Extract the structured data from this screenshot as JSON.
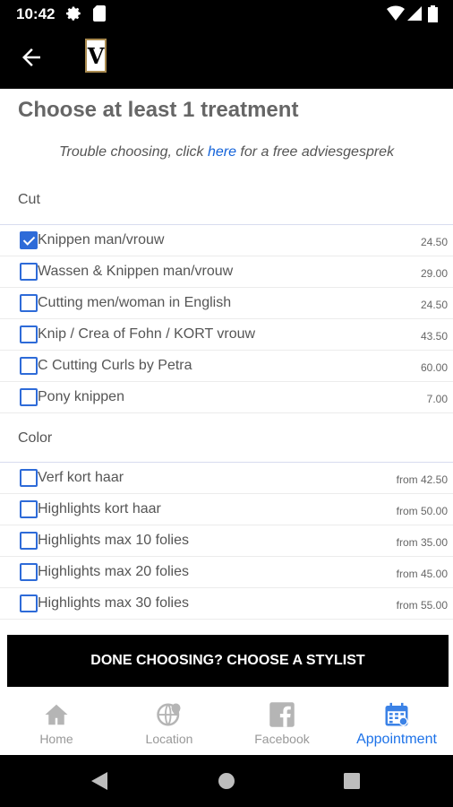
{
  "status_bar": {
    "time": "10:42",
    "icons": [
      "gear-icon",
      "sd-card-icon",
      "wifi-icon",
      "signal-icon",
      "battery-icon"
    ]
  },
  "app_bar": {
    "back_icon": "arrow-left-icon",
    "logo_text": "V"
  },
  "page": {
    "title": "Choose at least 1 treatment",
    "hint_prefix": "Trouble choosing, click ",
    "hint_link": "here",
    "hint_suffix": " for a free adviesgesprek"
  },
  "sections": [
    {
      "name": "Cut",
      "items": [
        {
          "label": "Knippen man/vrouw",
          "price": "24.50",
          "checked": true
        },
        {
          "label": "Wassen & Knippen man/vrouw",
          "price": "29.00",
          "checked": false
        },
        {
          "label": "Cutting men/woman in  English",
          "price": "24.50",
          "checked": false
        },
        {
          "label": "Knip / Crea of Fohn / KORT vrouw",
          "price": "43.50",
          "checked": false
        },
        {
          "label": "C Cutting Curls by Petra",
          "price": "60.00",
          "checked": false
        },
        {
          "label": "Pony knippen",
          "price": "7.00",
          "checked": false
        }
      ]
    },
    {
      "name": "Color",
      "items": [
        {
          "label": "Verf kort haar",
          "price": "from 42.50",
          "checked": false
        },
        {
          "label": "Highlights kort haar",
          "price": "from 50.00",
          "checked": false
        },
        {
          "label": "Highlights max 10 folies",
          "price": "from 35.00",
          "checked": false
        },
        {
          "label": "Highlights max 20 folies",
          "price": "from 45.00",
          "checked": false
        },
        {
          "label": "Highlights max 30 folies",
          "price": "from 55.00",
          "checked": false
        }
      ]
    }
  ],
  "cta": {
    "label": "DONE CHOOSING? CHOOSE A STYLIST"
  },
  "tabs": [
    {
      "label": "Home",
      "icon": "home-icon",
      "active": false
    },
    {
      "label": "Location",
      "icon": "globe-location-icon",
      "active": false
    },
    {
      "label": "Facebook",
      "icon": "facebook-icon",
      "active": false
    },
    {
      "label": "Appointment",
      "icon": "calendar-icon",
      "active": true
    }
  ],
  "colors": {
    "accent": "#1d72e8",
    "checkbox": "#2e6bd8",
    "bar": "#000000",
    "logo_border": "#a98a4f"
  }
}
